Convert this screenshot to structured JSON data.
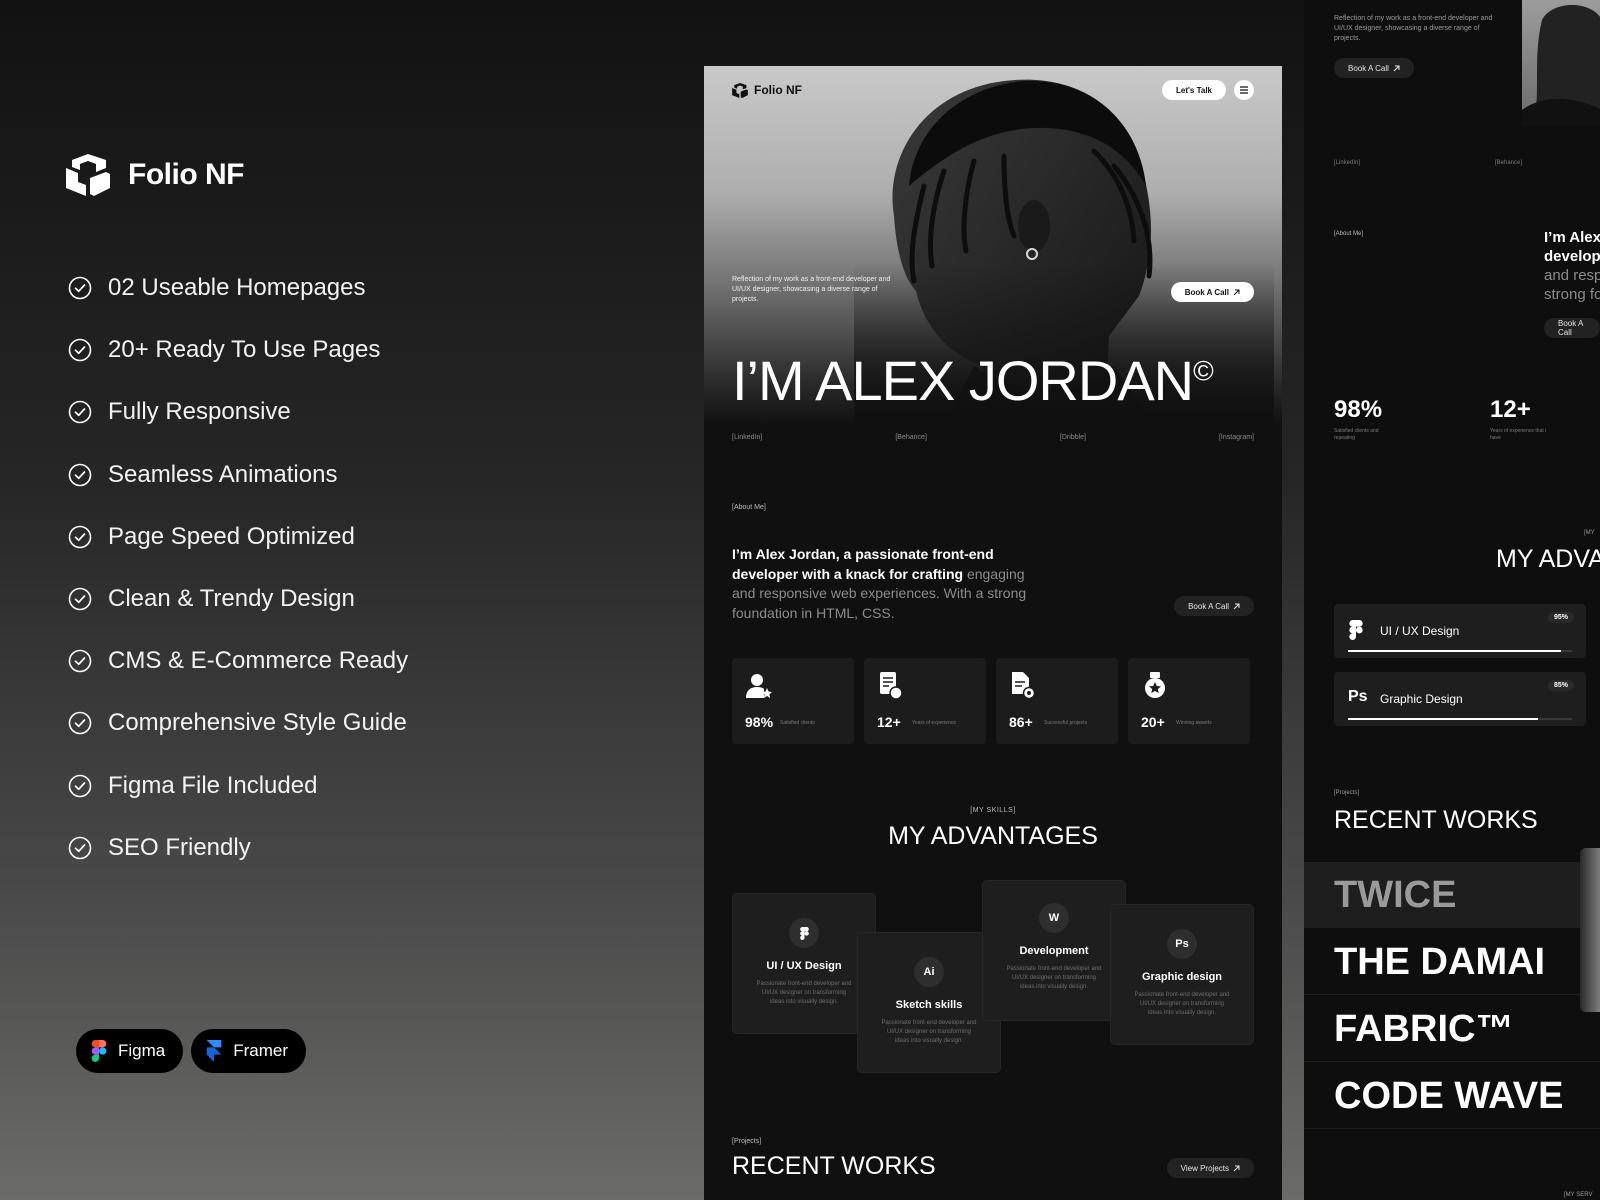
{
  "promo": {
    "brand": "Folio NF",
    "features": [
      "02 Useable Homepages",
      "20+ Ready To Use Pages",
      "Fully Responsive",
      "Seamless Animations",
      "Page Speed Optimized",
      "Clean & Trendy Design",
      "CMS & E-Commerce Ready",
      "Comprehensive Style Guide",
      "Figma File Included",
      "SEO Friendly"
    ],
    "tools": [
      "Figma",
      "Framer"
    ]
  },
  "mockup": {
    "logo": "Folio NF",
    "nav_cta": "Let's Talk",
    "hero_text": "Reflection of my work as a front-end developer and UI/UX designer, showcasing a diverse range of projects.",
    "book_call": "Book A Call",
    "hero_title": "I’M ALEX JORDAN",
    "hero_copyright": "©",
    "socials": [
      "[LinkedIn]",
      "[Behance]",
      "[Dribble]",
      "[Instagram]"
    ],
    "about_tag": "[About Me]",
    "about_bold": "I’m Alex Jordan, a passionate front-end developer with a knack for crafting",
    "about_dim": "engaging and responsive web experiences. With a strong foundation in HTML, CSS.",
    "stats": [
      {
        "value": "98%",
        "label": "Satisfied clients",
        "icon": "user-star-icon"
      },
      {
        "value": "12+",
        "label": "Years of experience",
        "icon": "document-badge-icon"
      },
      {
        "value": "86+",
        "label": "Successful projects",
        "icon": "file-gear-icon"
      },
      {
        "value": "20+",
        "label": "Winning awards",
        "icon": "award-medal-icon"
      }
    ],
    "skills_tag": "[MY SKILLS]",
    "skills_title": "MY ADVANTAGES",
    "advantages": [
      {
        "title": "UI / UX Design",
        "icon": "figma-icon",
        "glyph": "",
        "desc": "Passionate front-end developer and UI/UX designer on transforming ideas into visually design."
      },
      {
        "title": "Sketch skills",
        "icon": "illustrator-icon",
        "glyph": "Ai",
        "desc": "Passionate front-end developer and UI/UX designer on transforming ideas into visually design."
      },
      {
        "title": "Development",
        "icon": "webflow-icon",
        "glyph": "W",
        "desc": "Passionate front-end developer and UI/UX designer on transforming ideas into visually design."
      },
      {
        "title": "Graphic design",
        "icon": "photoshop-icon",
        "glyph": "Ps",
        "desc": "Passionate front-end developer and UI/UX designer on transforming ideas into visually design."
      }
    ],
    "projects_tag": "[Projects]",
    "projects_title": "RECENT WORKS",
    "view_projects": "View Projects"
  },
  "mockup2": {
    "hero_text": "Reflection of my work as a front-end developer and UI/UX designer, showcasing a diverse range of projects.",
    "book_call": "Book A Call",
    "links": [
      "[LinkedIn]",
      "[Behance]"
    ],
    "about_tag": "[About Me]",
    "bio_lines": [
      "I’m Alex",
      "develop"
    ],
    "bio_dim_lines": [
      "and resp",
      "strong fo"
    ],
    "stats": [
      {
        "value": "98%",
        "label": "Satisfied clients and repeating"
      },
      {
        "value": "12+",
        "label": "Years of experience that i have"
      }
    ],
    "skills_tag": "[MY",
    "skills_title": "MY ADVA",
    "skills": [
      {
        "label": "UI / UX Design",
        "pct": "95%",
        "value": 0.95,
        "icon": "figma-icon"
      },
      {
        "label": "Graphic Design",
        "pct": "85%",
        "value": 0.85,
        "icon": "photoshop-icon",
        "glyph": "Ps"
      }
    ],
    "projects_tag": "[Projects]",
    "projects_title": "RECENT WORKS",
    "works": [
      "TWICE",
      "THE DAMAI",
      "FABRIC™",
      "CODE WAVE"
    ],
    "services_tag": "[MY SERV"
  }
}
